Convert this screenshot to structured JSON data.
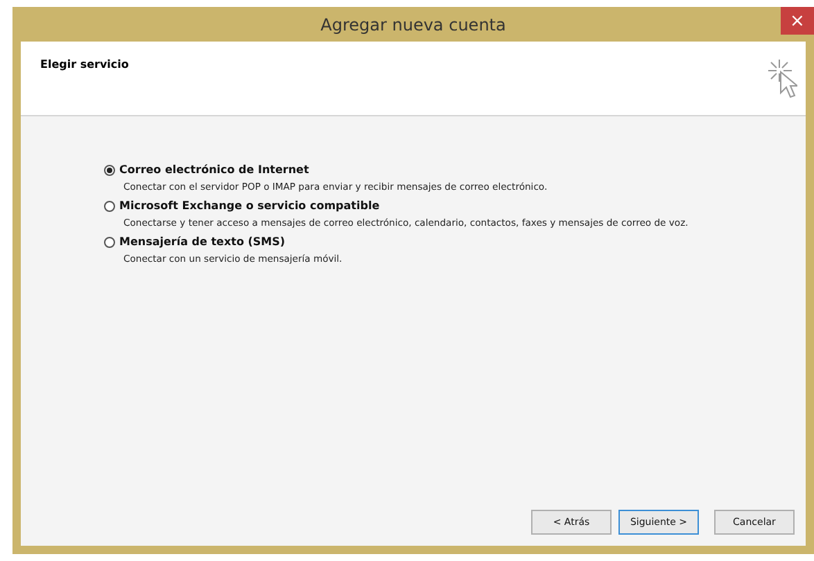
{
  "window": {
    "title": "Agregar nueva cuenta",
    "close": "×"
  },
  "header": {
    "title": "Elegir servicio"
  },
  "options": [
    {
      "label": "Correo electrónico de Internet",
      "description": "Conectar con el servidor POP o IMAP para enviar y recibir mensajes de correo electrónico.",
      "selected": true
    },
    {
      "label": "Microsoft Exchange o servicio compatible",
      "description": "Conectarse y tener acceso a mensajes de correo electrónico, calendario, contactos, faxes y mensajes de correo de voz.",
      "selected": false
    },
    {
      "label": "Mensajería de texto (SMS)",
      "description": "Conectar con un servicio de mensajería móvil.",
      "selected": false
    }
  ],
  "buttons": [
    {
      "label": "< Atrás",
      "default": false
    },
    {
      "label": "Siguiente >",
      "default": true
    },
    {
      "label": "Cancelar",
      "default": false
    }
  ]
}
